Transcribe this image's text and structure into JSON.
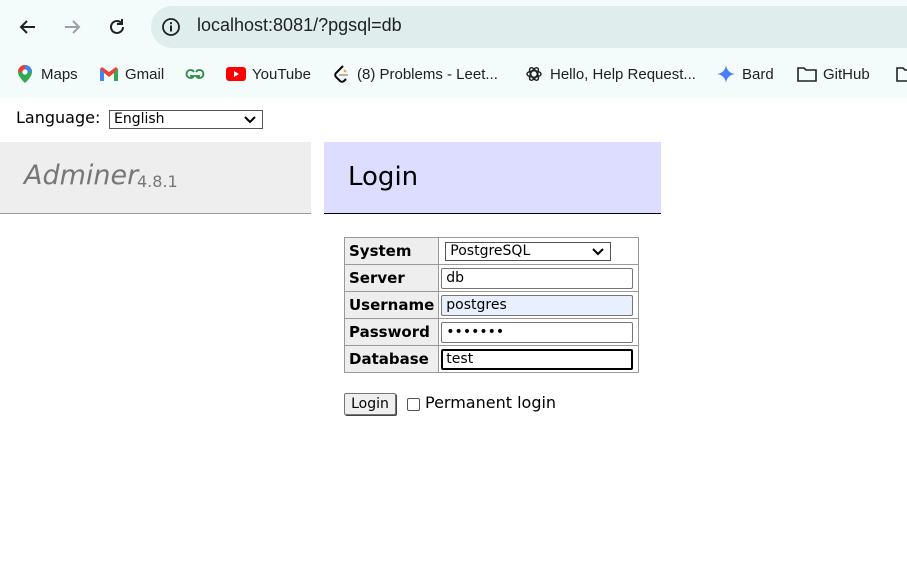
{
  "browser": {
    "url": "localhost:8081/?pgsql=db",
    "bookmarks": [
      {
        "label": "Maps",
        "icon": "maps-icon"
      },
      {
        "label": "Gmail",
        "icon": "gmail-icon"
      },
      {
        "label": "",
        "icon": "geeksforgeeks-icon"
      },
      {
        "label": "YouTube",
        "icon": "youtube-icon"
      },
      {
        "label": "(8) Problems - Leet...",
        "icon": "leetcode-icon"
      },
      {
        "label": "Hello, Help Request...",
        "icon": "openai-icon"
      },
      {
        "label": "Bard",
        "icon": "bard-icon"
      },
      {
        "label": "GitHub",
        "icon": "folder-icon"
      }
    ]
  },
  "language": {
    "label": "Language:",
    "selected": "English"
  },
  "menu": {
    "app_name": "Adminer",
    "version": "4.8.1"
  },
  "content": {
    "title": "Login"
  },
  "form": {
    "system_label": "System",
    "system_value": "PostgreSQL",
    "server_label": "Server",
    "server_value": "db",
    "username_label": "Username",
    "username_value": "postgres",
    "password_label": "Password",
    "password_value": "•••••••",
    "database_label": "Database",
    "database_value": "test",
    "login_button": "Login",
    "permanent_label": "Permanent login",
    "permanent_checked": false
  },
  "colors": {
    "menu_bg": "#eeeeee",
    "content_head_bg": "#ddddff",
    "omnibox_bg": "#dfeeed"
  }
}
